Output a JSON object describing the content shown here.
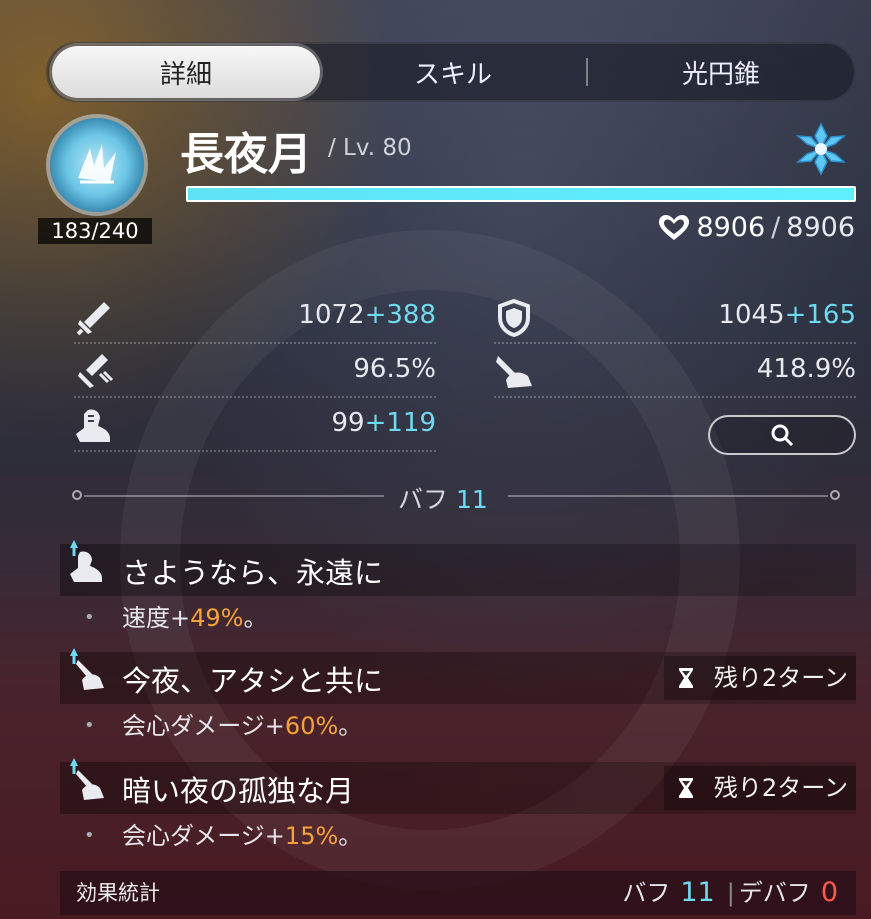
{
  "tabs": [
    {
      "label": "詳細",
      "active": true
    },
    {
      "label": "スキル",
      "active": false
    },
    {
      "label": "光円錐",
      "active": false
    }
  ],
  "character": {
    "name": "長夜月",
    "level": "/ Lv. 80",
    "energy": "183/240",
    "hp_current": "8906",
    "hp_separator": "/",
    "hp_max": "8906",
    "hp_fraction": 1.0,
    "element_icon": "ice-element-icon"
  },
  "stats": {
    "atk": {
      "icon": "sword-icon",
      "base": "1072",
      "bonus": "+388"
    },
    "def": {
      "icon": "shield-icon",
      "base": "1045",
      "bonus": "+165"
    },
    "crit_rate": {
      "icon": "crit-rate-icon",
      "value": "96.5%"
    },
    "crit_dmg": {
      "icon": "crit-dmg-icon",
      "value": "418.9%"
    },
    "spd": {
      "icon": "boot-icon",
      "base": "99",
      "bonus": "+119"
    }
  },
  "buff_divider": {
    "label": "バフ",
    "count": "11"
  },
  "buffs": [
    {
      "title": "さようなら、永遠に",
      "desc_prefix": "速度+",
      "desc_value": "49%",
      "desc_suffix": "。",
      "turns": ""
    },
    {
      "title": "今夜、アタシと共に",
      "desc_prefix": "会心ダメージ+",
      "desc_value": "60%",
      "desc_suffix": "。",
      "turns": "残り2ターン"
    },
    {
      "title": "暗い夜の孤独な月",
      "desc_prefix": "会心ダメージ+",
      "desc_value": "15%",
      "desc_suffix": "。",
      "turns": "残り2ターン"
    }
  ],
  "footer": {
    "label": "効果統計",
    "buff_label": "バフ",
    "buff_count": "11",
    "separator": "|",
    "debuff_label": "デバフ",
    "debuff_count": "0"
  },
  "colors": {
    "accent": "#6fd9ef",
    "highlight": "#f5a23c",
    "debuff": "#ff5a4a",
    "hp_bar": "#5ff0ff"
  }
}
